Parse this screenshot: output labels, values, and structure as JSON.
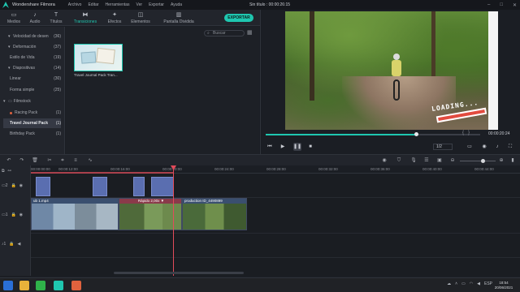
{
  "titlebar": {
    "app_name": "Wondershare Filmora",
    "menu": [
      "Archivo",
      "Editar",
      "Herramientas",
      "Ver",
      "Exportar",
      "Ayuda"
    ],
    "document": "Sin título : 00:00:26:15"
  },
  "toolbar": {
    "tabs": [
      {
        "label": "Medios",
        "icon": "folder-icon"
      },
      {
        "label": "Audio",
        "icon": "music-icon"
      },
      {
        "label": "Títulos",
        "icon": "text-icon"
      },
      {
        "label": "Transiciones",
        "icon": "transition-icon"
      },
      {
        "label": "Efectos",
        "icon": "effects-icon"
      },
      {
        "label": "Elementos",
        "icon": "elements-icon"
      },
      {
        "label": "Pantalla Dividida",
        "icon": "split-screen-icon"
      }
    ],
    "active_tab": "Transiciones",
    "export_label": "EXPORTAR"
  },
  "sidebar": {
    "items": [
      {
        "label": "Velocidad de desen",
        "count": "(36)",
        "arrow": "▾"
      },
      {
        "label": "Deformación",
        "count": "(37)",
        "arrow": "▾"
      },
      {
        "label": "Estilo de Vida",
        "count": "(19)",
        "arrow": ""
      },
      {
        "label": "Diapositivas",
        "count": "(14)",
        "arrow": "▾"
      },
      {
        "label": "Linear",
        "count": "(30)",
        "arrow": ""
      },
      {
        "label": "Forma simple",
        "count": "(25)",
        "arrow": ""
      },
      {
        "label": "Filmstock",
        "count": "",
        "arrow": "▾"
      },
      {
        "label": "Racing Pack",
        "count": "(1)",
        "arrow": ""
      },
      {
        "label": "Travel Journal Pack",
        "count": "(1)",
        "arrow": ""
      },
      {
        "label": "Birthday Pack",
        "count": "(1)",
        "arrow": ""
      }
    ],
    "selected": "Travel Journal Pack"
  },
  "media": {
    "search_placeholder": "Buscar",
    "thumb_label": "Travel Journal Pack Tran..."
  },
  "preview": {
    "overlay_text": "LOADING...",
    "progress": 0.7,
    "time": "00:00:20:24",
    "quality": "1/2"
  },
  "timeline": {
    "ticks": [
      "00:00:00:00",
      "00:00:12:00",
      "00:00:16:00",
      "00:00:20:00",
      "00:00:24:00",
      "00:00:28:00",
      "00:00:32:00",
      "00:00:36:00",
      "00:00:40:00",
      "00:00:44:00"
    ],
    "speed_label": "Rápido 2,00x ▼",
    "clip_label": "production ID_4490899",
    "clip_label_short": "ub 1.mp4"
  },
  "taskbar": {
    "time": "18:54",
    "date": "20/06/2021",
    "lang": "ESP"
  },
  "colors": {
    "accent": "#1fc7b0",
    "playhead": "#e24b5a",
    "transition": "#5a6eb0"
  }
}
